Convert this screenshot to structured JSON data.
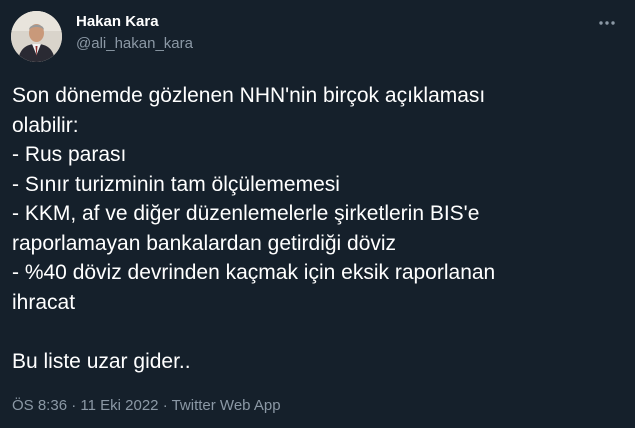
{
  "tweet": {
    "author": {
      "name": "Hakan Kara",
      "handle": "@ali_hakan_kara"
    },
    "more_icon": "more-dots-icon",
    "body_lines": [
      "Son dönemde gözlenen NHN'nin birçok açıklaması",
      "olabilir:",
      "- Rus parası",
      "- Sınır turizminin tam ölçülememesi",
      "- KKM, af ve diğer düzenlemelerle şirketlerin BIS'e",
      "raporlamayan bankalardan getirdiği döviz",
      "- %40 döviz devrinden kaçmak için eksik raporlanan",
      "ihracat",
      "",
      "Bu liste uzar gider.."
    ],
    "meta": {
      "time": "ÖS 8:36",
      "separator": "·",
      "date": "11 Eki 2022",
      "source": "Twitter Web App"
    }
  },
  "colors": {
    "background": "#15202b",
    "text": "#ffffff",
    "secondary": "#8b98a5"
  }
}
